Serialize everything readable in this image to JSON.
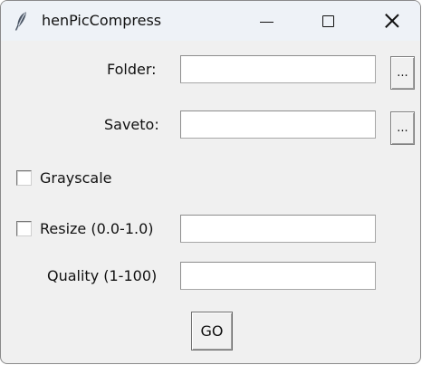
{
  "window": {
    "title": "henPicCompress",
    "controls": {
      "minimize": "minimize",
      "maximize": "maximize",
      "close": "close"
    }
  },
  "form": {
    "folder": {
      "label": "Folder:",
      "value": "",
      "browse_label": "..."
    },
    "saveto": {
      "label": "Saveto:",
      "value": "",
      "browse_label": "..."
    },
    "grayscale": {
      "label": "Grayscale",
      "checked": false
    },
    "resize": {
      "label": "Resize (0.0-1.0)",
      "checked": false,
      "value": ""
    },
    "quality": {
      "label": "Quality (1-100)",
      "value": ""
    },
    "go_label": "GO"
  },
  "icons": {
    "app": "feather-icon",
    "minimize": "minimize-icon",
    "maximize": "maximize-icon",
    "close": "close-icon"
  },
  "colors": {
    "window_bg": "#f0f0f0",
    "titlebar_bg": "#eef2f7",
    "feather": "#4a5564"
  }
}
